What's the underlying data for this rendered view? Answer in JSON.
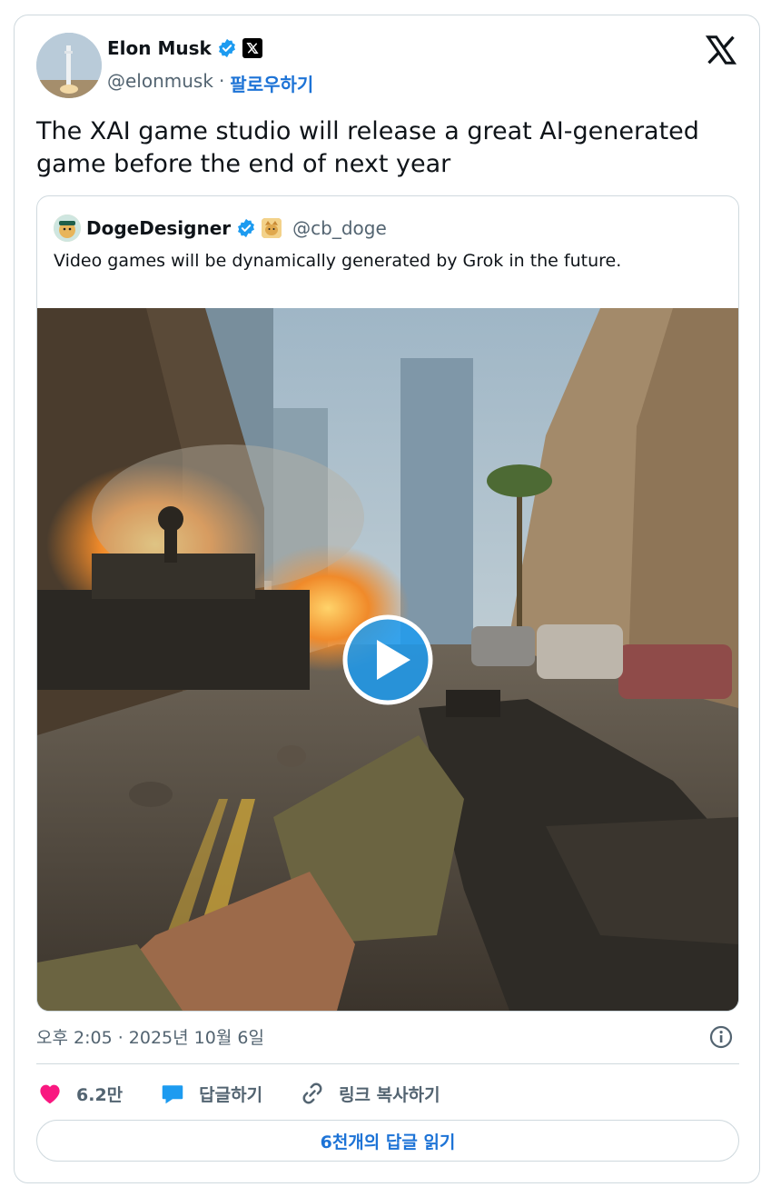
{
  "author": {
    "name": "Elon Musk",
    "handle": "@elonmusk",
    "separator": "·",
    "follow_label": "팔로우하기"
  },
  "tweet": {
    "text": "The XAI game studio will release a great AI-generated game before the end of next year"
  },
  "quote": {
    "name": "DogeDesigner",
    "handle": "@cb_doge",
    "text": "Video games will be dynamically generated by Grok in the future."
  },
  "meta": {
    "timestamp": "오후 2:05 · 2025년 10월 6일"
  },
  "actions": {
    "likes": "6.2만",
    "reply_label": "답글하기",
    "copy_link_label": "링크 복사하기"
  },
  "read_replies_label": "6천개의 답글 읽기",
  "icons": {
    "verified": "verified-badge-icon",
    "x_logo": "x-logo-icon",
    "info": "info-icon",
    "heart": "heart-icon",
    "reply": "reply-bubble-icon",
    "link": "link-icon",
    "play": "play-icon"
  },
  "colors": {
    "accent": "#1d73d6",
    "verified": "#1d9bf0",
    "heart": "#f91880",
    "muted": "#536471",
    "border": "#cfd9de"
  }
}
